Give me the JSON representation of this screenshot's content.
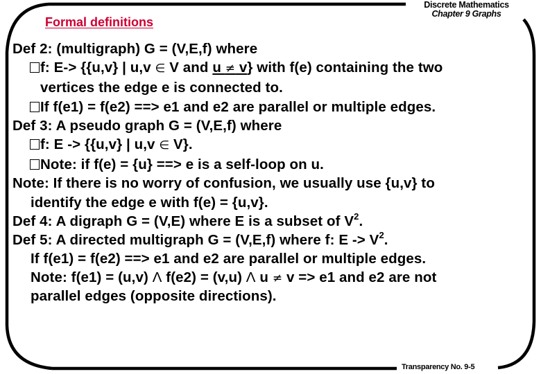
{
  "header": {
    "section_title": "Formal definitions",
    "course": "Discrete Mathematics",
    "chapter": "Chapter 9 Graphs"
  },
  "footer": {
    "transparency": "Transparency No. 9-5"
  },
  "colors": {
    "title_red": "#cc0033",
    "text": "#000000",
    "frame": "#000000"
  },
  "content": {
    "def2": {
      "head": "Def 2: (multigraph) G = (V,E,f) where",
      "b1_a": "f: E-> {{u,v} | u,v ",
      "b1_in": "∈",
      "b1_b": " V and ",
      "b1_u": "u ",
      "b1_neq": "≠",
      "b1_v": " v",
      "b1_c": "} with f(e) containing the two",
      "b1_cont": "vertices the edge e is connected to.",
      "b2": "If f(e1) = f(e2)  ==> e1 and e2 are parallel or multiple edges."
    },
    "def3": {
      "head": "Def 3: A pseudo graph G = (V,E,f) where",
      "b1_a": "f: E -> {{u,v} | u,v ",
      "b1_in": "∈",
      "b1_b": " V}.",
      "b2": "Note: if f(e) = {u}  ==> e is a self-loop on u."
    },
    "note": {
      "line1": "Note: If there is no worry of confusion, we usually use {u,v} to",
      "line2": "identify the edge e with f(e) = {u,v}."
    },
    "def4": {
      "text": "Def 4: A digraph G = (V,E) where E is a subset of V",
      "sup": "2",
      "end": "."
    },
    "def5": {
      "text": "Def 5: A directed multigraph G = (V,E,f) where f: E -> V",
      "sup": "2",
      "end": ".",
      "line2": "If f(e1) = f(e2) ==> e1 and e2 are parallel or multiple edges.",
      "note_a": "Note: f(e1) = (u,v) ",
      "and1": "Λ",
      "note_b": " f(e2) = (v,u) ",
      "and2": "Λ",
      "note_c": " u ",
      "neq": "≠",
      "note_d": " v => e1 and e2 are not",
      "note_cont": "parallel edges (opposite directions)."
    }
  }
}
